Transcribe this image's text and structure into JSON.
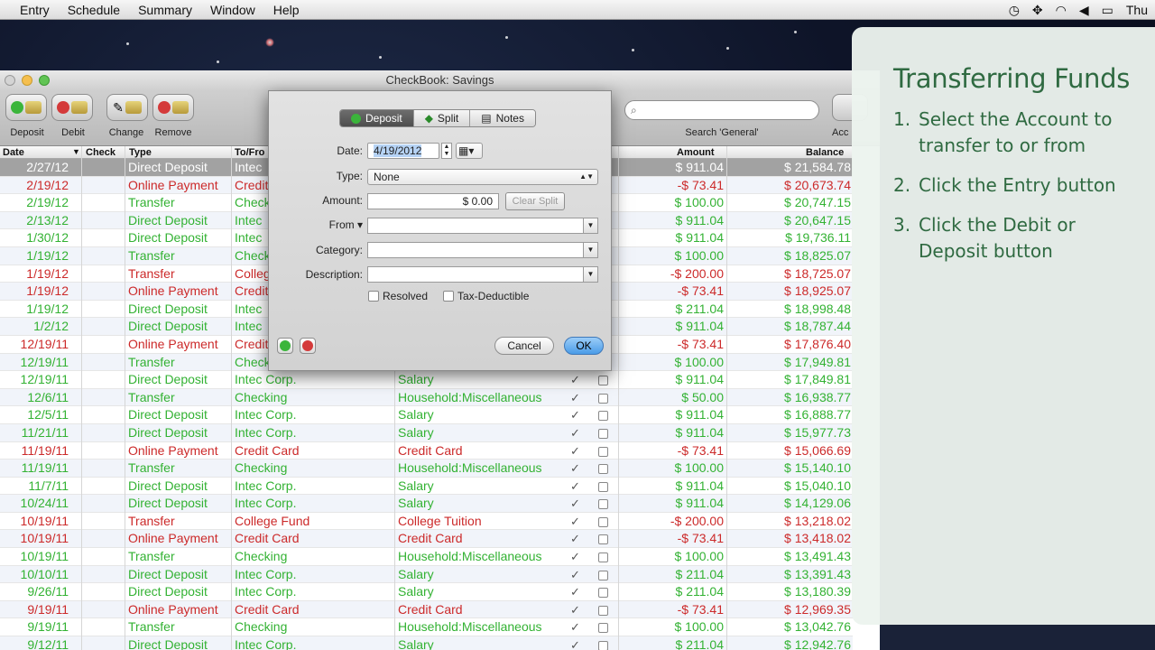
{
  "menubar": {
    "items": [
      "Entry",
      "Schedule",
      "Summary",
      "Window",
      "Help"
    ],
    "clock": "Thu"
  },
  "window": {
    "title": "CheckBook:  Savings"
  },
  "toolbar": {
    "deposit": "Deposit",
    "debit": "Debit",
    "change": "Change",
    "remove": "Remove",
    "search_label": "Search 'General'",
    "accounts": "Acc"
  },
  "table": {
    "headers": {
      "date": "Date",
      "check": "Check",
      "type": "Type",
      "to": "To/Fro",
      "amount": "Amount",
      "balance": "Balance"
    },
    "rows": [
      {
        "date": "2/27/12",
        "type": "Direct Deposit",
        "to": "Intec",
        "cat": "",
        "r": false,
        "amt": "$ 911.04",
        "bal": "$ 21,584.78",
        "c": "g",
        "sel": true
      },
      {
        "date": "2/19/12",
        "type": "Online Payment",
        "to": "Credit",
        "cat": "",
        "r": false,
        "amt": "-$ 73.41",
        "bal": "$ 20,673.74",
        "c": "r"
      },
      {
        "date": "2/19/12",
        "type": "Transfer",
        "to": "Check",
        "cat": "",
        "r": false,
        "amt": "$ 100.00",
        "bal": "$ 20,747.15",
        "c": "g"
      },
      {
        "date": "2/13/12",
        "type": "Direct Deposit",
        "to": "Intec",
        "cat": "",
        "r": false,
        "amt": "$ 911.04",
        "bal": "$ 20,647.15",
        "c": "g"
      },
      {
        "date": "1/30/12",
        "type": "Direct Deposit",
        "to": "Intec",
        "cat": "",
        "r": false,
        "amt": "$ 911.04",
        "bal": "$ 19,736.11",
        "c": "g"
      },
      {
        "date": "1/19/12",
        "type": "Transfer",
        "to": "Check",
        "cat": "",
        "r": false,
        "amt": "$ 100.00",
        "bal": "$ 18,825.07",
        "c": "g"
      },
      {
        "date": "1/19/12",
        "type": "Transfer",
        "to": "Colleg",
        "cat": "",
        "r": false,
        "amt": "-$ 200.00",
        "bal": "$ 18,725.07",
        "c": "r"
      },
      {
        "date": "1/19/12",
        "type": "Online Payment",
        "to": "Credit",
        "cat": "",
        "r": false,
        "amt": "-$ 73.41",
        "bal": "$ 18,925.07",
        "c": "r"
      },
      {
        "date": "1/19/12",
        "type": "Direct Deposit",
        "to": "Intec",
        "cat": "",
        "r": false,
        "amt": "$ 211.04",
        "bal": "$ 18,998.48",
        "c": "g"
      },
      {
        "date": "1/2/12",
        "type": "Direct Deposit",
        "to": "Intec",
        "cat": "",
        "r": false,
        "amt": "$ 911.04",
        "bal": "$ 18,787.44",
        "c": "g"
      },
      {
        "date": "12/19/11",
        "type": "Online Payment",
        "to": "Credit",
        "cat": "",
        "r": false,
        "amt": "-$ 73.41",
        "bal": "$ 17,876.40",
        "c": "r"
      },
      {
        "date": "12/19/11",
        "type": "Transfer",
        "to": "Check",
        "cat": "",
        "r": false,
        "amt": "$ 100.00",
        "bal": "$ 17,949.81",
        "c": "g"
      },
      {
        "date": "12/19/11",
        "type": "Direct Deposit",
        "to": "Intec Corp.",
        "cat": "Salary",
        "r": true,
        "amt": "$ 911.04",
        "bal": "$ 17,849.81",
        "c": "g"
      },
      {
        "date": "12/6/11",
        "type": "Transfer",
        "to": "Checking",
        "cat": "Household:Miscellaneous",
        "r": true,
        "amt": "$ 50.00",
        "bal": "$ 16,938.77",
        "c": "g"
      },
      {
        "date": "12/5/11",
        "type": "Direct Deposit",
        "to": "Intec Corp.",
        "cat": "Salary",
        "r": true,
        "amt": "$ 911.04",
        "bal": "$ 16,888.77",
        "c": "g"
      },
      {
        "date": "11/21/11",
        "type": "Direct Deposit",
        "to": "Intec Corp.",
        "cat": "Salary",
        "r": true,
        "amt": "$ 911.04",
        "bal": "$ 15,977.73",
        "c": "g"
      },
      {
        "date": "11/19/11",
        "type": "Online Payment",
        "to": "Credit Card",
        "cat": "Credit Card",
        "r": true,
        "amt": "-$ 73.41",
        "bal": "$ 15,066.69",
        "c": "r"
      },
      {
        "date": "11/19/11",
        "type": "Transfer",
        "to": "Checking",
        "cat": "Household:Miscellaneous",
        "r": true,
        "amt": "$ 100.00",
        "bal": "$ 15,140.10",
        "c": "g"
      },
      {
        "date": "11/7/11",
        "type": "Direct Deposit",
        "to": "Intec Corp.",
        "cat": "Salary",
        "r": true,
        "amt": "$ 911.04",
        "bal": "$ 15,040.10",
        "c": "g"
      },
      {
        "date": "10/24/11",
        "type": "Direct Deposit",
        "to": "Intec Corp.",
        "cat": "Salary",
        "r": true,
        "amt": "$ 911.04",
        "bal": "$ 14,129.06",
        "c": "g"
      },
      {
        "date": "10/19/11",
        "type": "Transfer",
        "to": "College Fund",
        "cat": "College Tuition",
        "r": true,
        "amt": "-$ 200.00",
        "bal": "$ 13,218.02",
        "c": "r"
      },
      {
        "date": "10/19/11",
        "type": "Online Payment",
        "to": "Credit Card",
        "cat": "Credit Card",
        "r": true,
        "amt": "-$ 73.41",
        "bal": "$ 13,418.02",
        "c": "r"
      },
      {
        "date": "10/19/11",
        "type": "Transfer",
        "to": "Checking",
        "cat": "Household:Miscellaneous",
        "r": true,
        "amt": "$ 100.00",
        "bal": "$ 13,491.43",
        "c": "g"
      },
      {
        "date": "10/10/11",
        "type": "Direct Deposit",
        "to": "Intec Corp.",
        "cat": "Salary",
        "r": true,
        "amt": "$ 211.04",
        "bal": "$ 13,391.43",
        "c": "g"
      },
      {
        "date": "9/26/11",
        "type": "Direct Deposit",
        "to": "Intec Corp.",
        "cat": "Salary",
        "r": true,
        "amt": "$ 211.04",
        "bal": "$ 13,180.39",
        "c": "g"
      },
      {
        "date": "9/19/11",
        "type": "Online Payment",
        "to": "Credit Card",
        "cat": "Credit Card",
        "r": true,
        "amt": "-$ 73.41",
        "bal": "$ 12,969.35",
        "c": "r"
      },
      {
        "date": "9/19/11",
        "type": "Transfer",
        "to": "Checking",
        "cat": "Household:Miscellaneous",
        "r": true,
        "amt": "$ 100.00",
        "bal": "$ 13,042.76",
        "c": "g"
      },
      {
        "date": "9/12/11",
        "type": "Direct Deposit",
        "to": "Intec Corp.",
        "cat": "Salary",
        "r": true,
        "amt": "$ 211.04",
        "bal": "$ 12,942.76",
        "c": "g"
      }
    ]
  },
  "dialog": {
    "tabs": [
      "Deposit",
      "Split",
      "Notes"
    ],
    "date_label": "Date:",
    "date_value": "4/19/2012",
    "type_label": "Type:",
    "type_value": "None",
    "amount_label": "Amount:",
    "amount_value": "$ 0.00",
    "clear_split": "Clear Split",
    "from_label": "From ▾",
    "category_label": "Category:",
    "description_label": "Description:",
    "resolved": "Resolved",
    "tax": "Tax-Deductible",
    "cancel": "Cancel",
    "ok": "OK"
  },
  "panel": {
    "title": "Transferring Funds",
    "steps": [
      {
        "n": "1.",
        "text": "Select the Account to transfer to or from"
      },
      {
        "n": "2.",
        "text": "Click the Entry button"
      },
      {
        "n": "3.",
        "text": "Click the Debit or Deposit button"
      }
    ]
  },
  "colors": {
    "green": "#33b233",
    "red": "#cc2a2a",
    "panel_text": "#2f6a41"
  }
}
